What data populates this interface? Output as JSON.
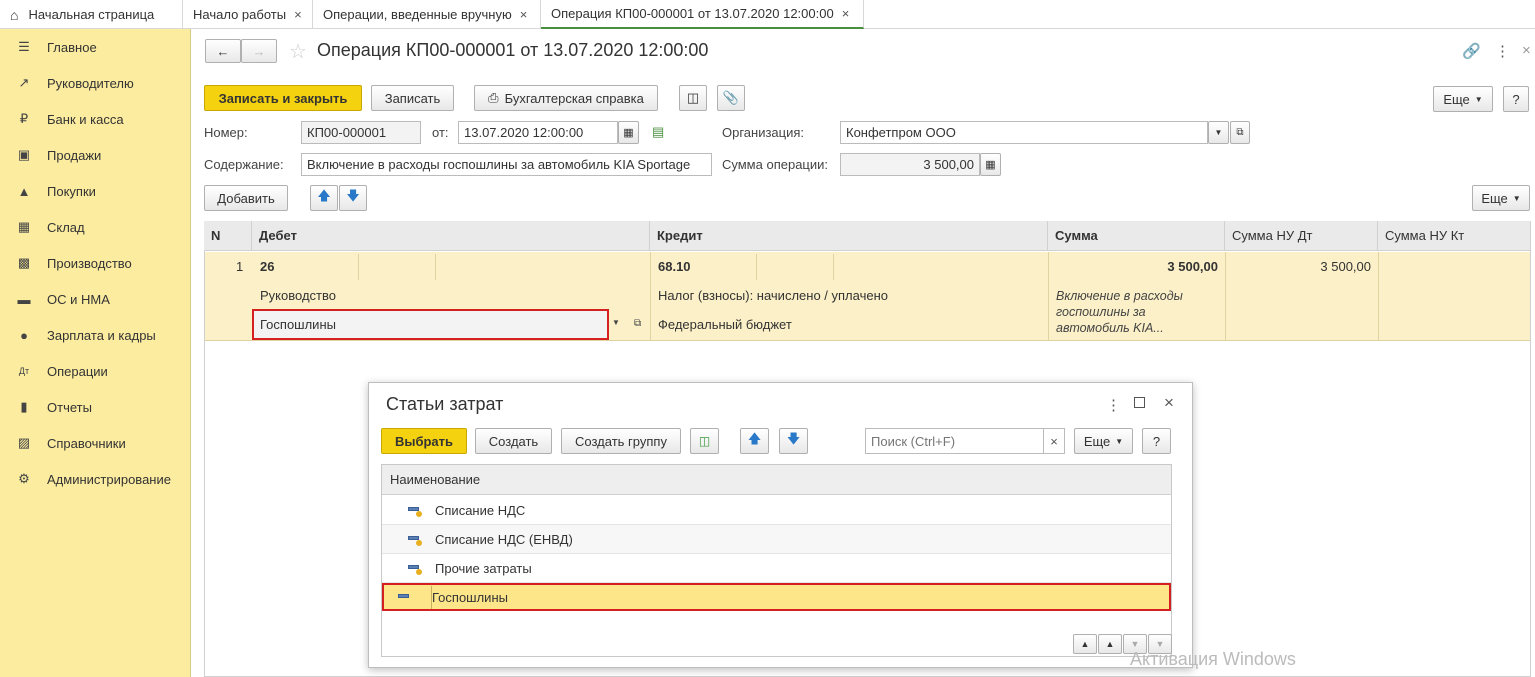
{
  "tabs": {
    "home": "Начальная страница",
    "t1": "Начало работы",
    "t2": "Операции, введенные вручную",
    "t3": "Операция КП00-000001 от 13.07.2020 12:00:00",
    "close": "×"
  },
  "sidebar": [
    {
      "label": "Главное",
      "icon": "menu-icon"
    },
    {
      "label": "Руководителю",
      "icon": "trend-icon"
    },
    {
      "label": "Банк и касса",
      "icon": "ruble-icon"
    },
    {
      "label": "Продажи",
      "icon": "bag-icon"
    },
    {
      "label": "Покупки",
      "icon": "cart-icon"
    },
    {
      "label": "Склад",
      "icon": "warehouse-icon"
    },
    {
      "label": "Производство",
      "icon": "factory-icon"
    },
    {
      "label": "ОС и НМА",
      "icon": "truck-icon"
    },
    {
      "label": "Зарплата и кадры",
      "icon": "person-icon"
    },
    {
      "label": "Операции",
      "icon": "dt-kt-icon"
    },
    {
      "label": "Отчеты",
      "icon": "chart-icon"
    },
    {
      "label": "Справочники",
      "icon": "book-icon"
    },
    {
      "label": "Администрирование",
      "icon": "gear-icon"
    }
  ],
  "doc": {
    "title": "Операция КП00-000001 от 13.07.2020 12:00:00",
    "btn_save_close": "Записать и закрыть",
    "btn_save": "Записать",
    "btn_report": "Бухгалтерская справка",
    "btn_more": "Еще",
    "btn_help": "?",
    "number_label": "Номер:",
    "number_value": "КП00-000001",
    "from_label": "от:",
    "date_value": "13.07.2020 12:00:00",
    "org_label": "Организация:",
    "org_value": "Конфетпром ООО",
    "content_label": "Содержание:",
    "content_value": "Включение в расходы госпошлины за автомобиль KIA Sportage",
    "sum_label": "Сумма операции:",
    "sum_value": "3 500,00",
    "btn_add": "Добавить"
  },
  "table": {
    "headers": [
      "N",
      "Дебет",
      "Кредит",
      "Сумма",
      "Сумма НУ Дт",
      "Сумма НУ Кт"
    ],
    "row": {
      "n": "1",
      "debit": "26",
      "credit": "68.10",
      "sum": "3 500,00",
      "sum_nu_dt": "3 500,00",
      "debit_sub1": "Руководство",
      "debit_sub2": "Госпошлины",
      "credit_sub1": "Налог (взносы): начислено / уплачено",
      "credit_sub2": "Федеральный бюджет",
      "desc": "Включение в расходы госпошлины за автомобиль KIA..."
    }
  },
  "dialog": {
    "title": "Статьи затрат",
    "btn_select": "Выбрать",
    "btn_create": "Создать",
    "btn_create_group": "Создать группу",
    "search_placeholder": "Поиск (Ctrl+F)",
    "btn_more": "Еще",
    "btn_help": "?",
    "col_name": "Наименование",
    "items": [
      "Списание НДС",
      "Списание НДС (ЕНВД)",
      "Прочие затраты",
      "Госпошлины"
    ]
  },
  "watermark": "Активация Windows",
  "colors": {
    "accent_yellow": "#f5d20f",
    "sidebar": "#fbeca0",
    "highlight_red": "#d42020",
    "selected_row": "#fde68a"
  }
}
